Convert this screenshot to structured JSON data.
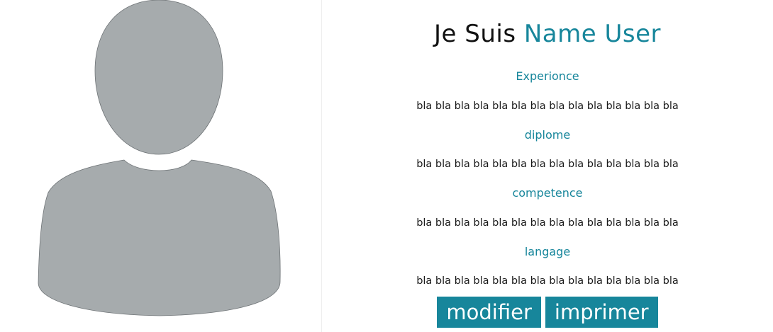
{
  "profile": {
    "title_prefix": "Je Suis",
    "title_name": "Name User"
  },
  "sections": [
    {
      "heading": "Experionce",
      "text": "bla bla bla bla bla bla bla bla bla bla bla bla bla bla"
    },
    {
      "heading": "diplome",
      "text": "bla bla bla bla bla bla bla bla bla bla bla bla bla bla"
    },
    {
      "heading": "competence",
      "text": "bla bla bla bla bla bla bla bla bla bla bla bla bla bla"
    },
    {
      "heading": "langage",
      "text": "bla bla bla bla bla bla bla bla bla bla bla bla bla bla"
    }
  ],
  "actions": {
    "modify_label": "modifier",
    "print_label": "imprimer"
  },
  "colors": {
    "accent": "#17869b",
    "avatar_fill": "#a6abad",
    "text": "#111111"
  },
  "icons": {
    "avatar": "user-silhouette-icon"
  }
}
